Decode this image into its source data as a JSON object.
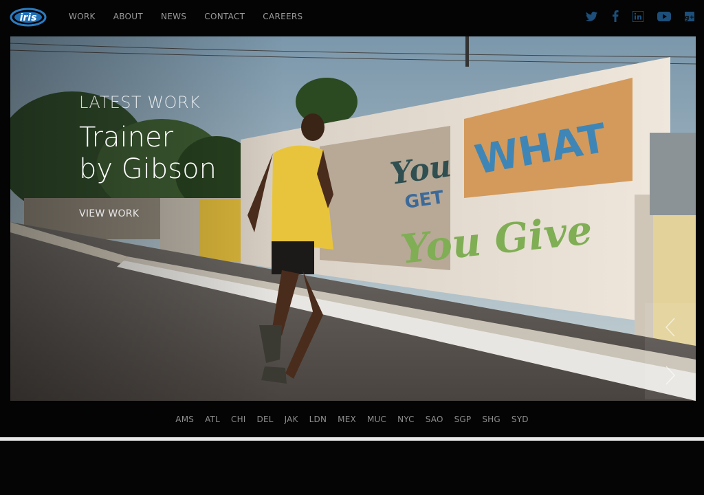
{
  "header": {
    "logo_text": "iris",
    "nav": [
      "WORK",
      "ABOUT",
      "NEWS",
      "CONTACT",
      "CAREERS"
    ],
    "social": [
      "twitter-icon",
      "facebook-icon",
      "linkedin-icon",
      "youtube-icon",
      "google-plus-icon"
    ]
  },
  "hero": {
    "kicker": "LATEST WORK",
    "headline_line1": "Trainer",
    "headline_line2": "by Gibson",
    "cta": "VIEW WORK",
    "mural_line1": "You",
    "mural_line2": "GET",
    "mural_line3": "WHAT",
    "mural_line4": "You Give"
  },
  "offices": [
    "AMS",
    "ATL",
    "CHI",
    "DEL",
    "JAK",
    "LDN",
    "MEX",
    "MUC",
    "NYC",
    "SAO",
    "SGP",
    "SHG",
    "SYD"
  ],
  "colors": {
    "accent_blue": "#1f6fb6",
    "social_blue": "#1d4f7a",
    "background": "#040404"
  }
}
